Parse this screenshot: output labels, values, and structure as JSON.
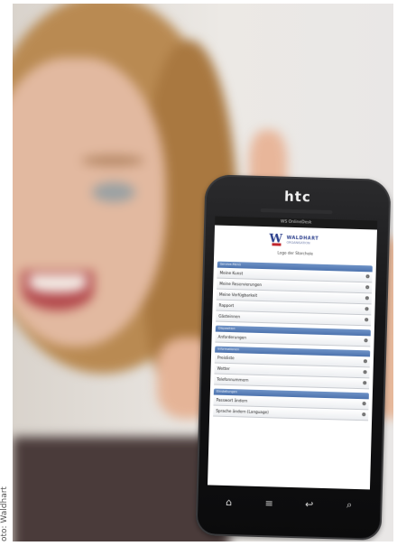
{
  "credit": "oto: Waldhart",
  "phone": {
    "brand": "htc",
    "status_title": "WS OnlineDesk",
    "logo": {
      "mark": "W",
      "name": "WALDHART",
      "tagline": "ORGANISATION",
      "caption": "Logo der Storchele"
    },
    "sections": [
      {
        "title": "Service-Menü",
        "items": [
          "Meine Kunst",
          "Meine Reservierungen",
          "Meine Verfügbarkeit",
          "Rapport",
          "Gästeinnen"
        ]
      },
      {
        "title": "Disposition",
        "items": [
          "Anforderungen"
        ]
      },
      {
        "title": "Informationen",
        "items": [
          "Preisliste",
          "Wetter",
          "Telefonnummern"
        ]
      },
      {
        "title": "Einstellungen",
        "items": [
          "Passwort ändern",
          "Sprache ändern (Language)"
        ]
      }
    ],
    "nav_icons": [
      "home-icon",
      "menu-icon",
      "back-icon",
      "search-icon"
    ]
  }
}
